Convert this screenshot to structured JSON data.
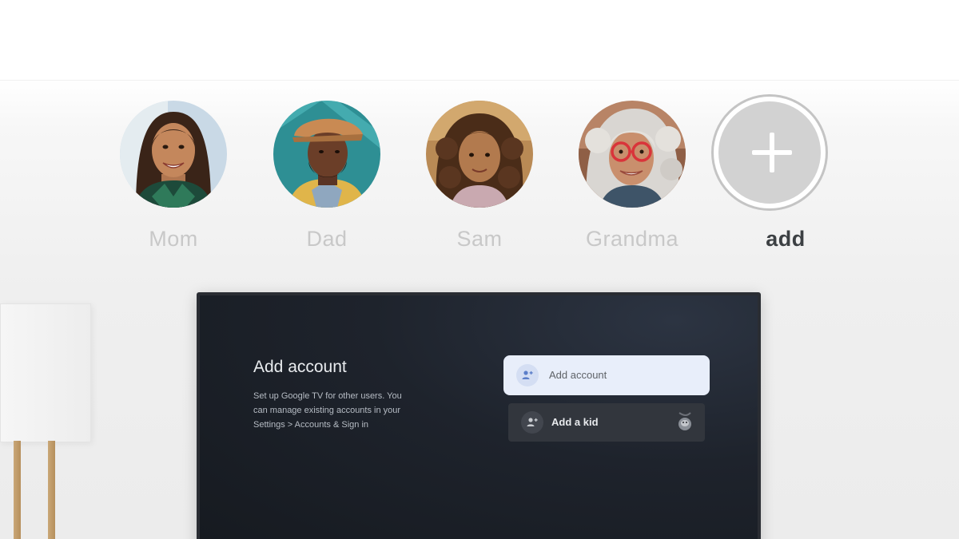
{
  "profiles": [
    {
      "name": "Mom",
      "icon": "avatar-photo"
    },
    {
      "name": "Dad",
      "icon": "avatar-photo"
    },
    {
      "name": "Sam",
      "icon": "avatar-photo"
    },
    {
      "name": "Grandma",
      "icon": "avatar-photo"
    }
  ],
  "add_profile": {
    "label": "add",
    "icon": "plus-icon"
  },
  "tv": {
    "title": "Add account",
    "description": "Set up Google TV for other users. You can manage existing accounts in your Settings > Accounts & Sign in",
    "buttons": [
      {
        "label": "Add account",
        "icon": "add-person-icon",
        "state": "focused"
      },
      {
        "label": "Add a kid",
        "icon": "add-person-icon",
        "decoration": "sloth-icon"
      }
    ]
  },
  "colors": {
    "inactive_name": "#c8c8c8",
    "active_name": "#3c4043",
    "focused_button": "#e8eefa",
    "screen": "#1e232c"
  }
}
